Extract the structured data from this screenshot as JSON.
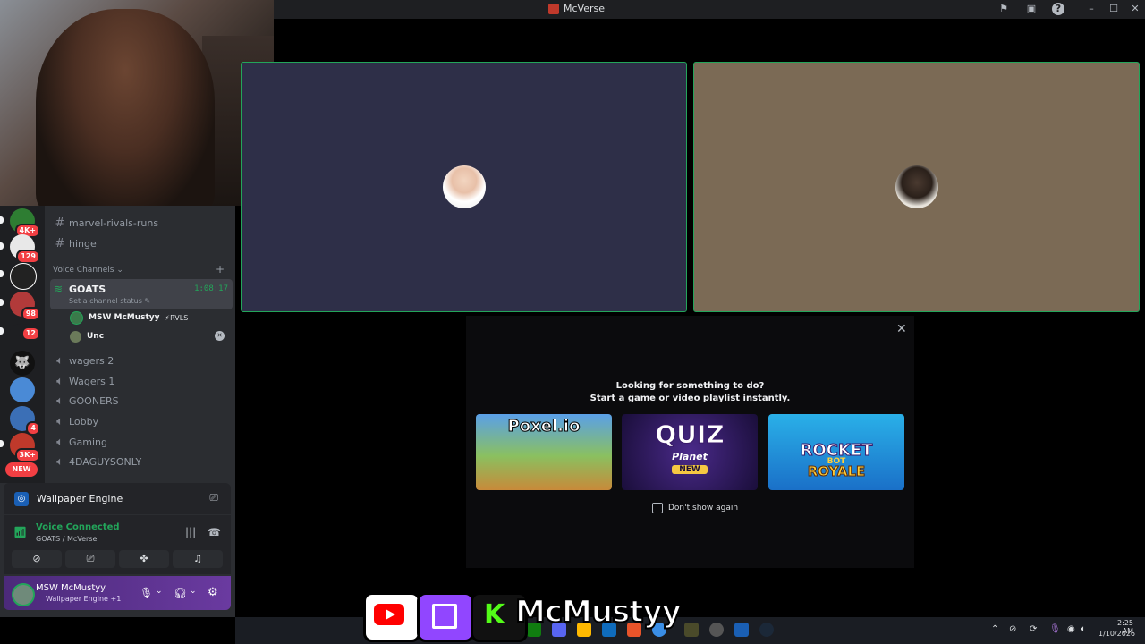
{
  "window": {
    "title": "McVerse"
  },
  "servers": [
    {
      "badge": "4K+"
    },
    {
      "badge": "129"
    },
    {
      "badge": ""
    },
    {
      "badge": "98"
    },
    {
      "badge": "12"
    },
    {
      "badge": ""
    },
    {
      "badge": ""
    },
    {
      "badge": "4"
    },
    {
      "badge": "3K+"
    }
  ],
  "servers_new_label": "NEW",
  "channels": {
    "text": [
      {
        "name": "marvel-rivals-runs"
      },
      {
        "name": "hinge"
      }
    ],
    "voice_category": "Voice Channels",
    "active_voice": {
      "name": "GOATS",
      "status_hint": "Set a channel status",
      "timer": "1:08:17",
      "users": [
        {
          "name": "MSW McMustyy",
          "tag": "⚡RVLS"
        },
        {
          "name": "Unc",
          "tag": ""
        }
      ]
    },
    "voice": [
      {
        "name": "wagers 2"
      },
      {
        "name": "Wagers 1"
      },
      {
        "name": "GOONERS"
      },
      {
        "name": "Lobby"
      },
      {
        "name": "Gaming"
      },
      {
        "name": "4DAGUYSONLY"
      }
    ]
  },
  "activity_panel": {
    "app": "Wallpaper Engine"
  },
  "voice_panel": {
    "status": "Voice Connected",
    "location": "GOATS / McVerse"
  },
  "user_panel": {
    "username": "MSW McMustyy",
    "activity": "Wallpaper Engine +1"
  },
  "modal": {
    "line1": "Looking for something to do?",
    "line2": "Start a game or video playlist instantly.",
    "games": [
      {
        "title": "Poxel.io"
      },
      {
        "title": "QUIZ",
        "subtitle": "Planet",
        "tag": "NEW"
      },
      {
        "title": "ROCKET",
        "subtitle": "BOT",
        "extra": "ROYALE"
      }
    ],
    "checkbox_label": "Don't show again"
  },
  "stream_overlay": {
    "name": "McMustyy"
  },
  "taskbar": {
    "time": "2:25 AM",
    "date": "1/10/2026"
  },
  "colors": {
    "speaking_border": "#23a55a",
    "tile1_bg": "#2e2f48",
    "tile2_bg": "#7b6a55",
    "accent_green": "#23a55a",
    "user_panel_purple": "#5a3290"
  }
}
